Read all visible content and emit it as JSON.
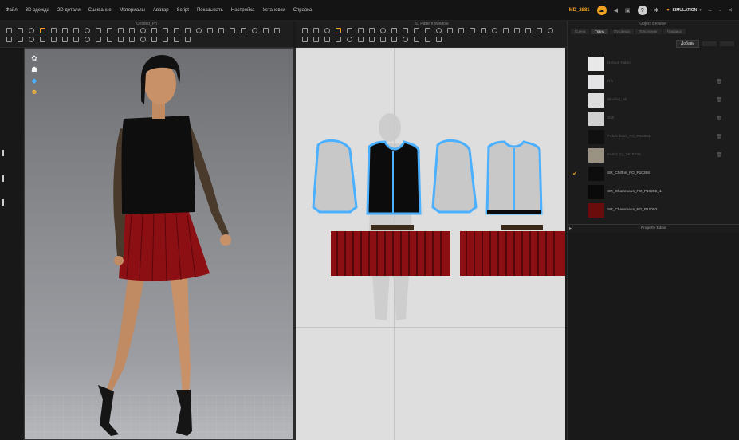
{
  "menubar": {
    "items": [
      "Файл",
      "3D одежда",
      "2D детали",
      "Сшивание",
      "Материалы",
      "Аватар",
      "Script",
      "Показывать",
      "Настройка",
      "Установки",
      "Справка"
    ],
    "project_badge": "MD_2881",
    "simulation_label": "SIMULATION"
  },
  "toolbar3d": {
    "title": "Untitled_Ph"
  },
  "toolbar2d": {
    "title": "2D Pattern Window"
  },
  "object_browser": {
    "title": "Object Browser",
    "tabs": [
      "Сцена",
      "Ткань",
      "Пуговица",
      "Топстичинг",
      "Графика"
    ],
    "active_tab": 1,
    "add_label": "Добавь",
    "fabrics": [
      {
        "name": "Default Fabric",
        "color": "#e8e8e8",
        "selected": false,
        "dim": true
      },
      {
        "name": "Rib",
        "color": "#e4e4e6",
        "selected": false,
        "dim": true
      },
      {
        "name": "Binding_Bk",
        "color": "#dcdcdc",
        "selected": false,
        "dim": true
      },
      {
        "name": "Sofi",
        "color": "#d0d0d0",
        "selected": false,
        "dim": true
      },
      {
        "name": "Fabric Dark_FC_PS2061",
        "color": "#101010",
        "selected": false,
        "dim": true
      },
      {
        "name": "Fabric Cy_MCB205",
        "color": "#9a9282",
        "selected": false,
        "dim": true
      },
      {
        "name": "SR_Chiffon_FO_P10398",
        "color": "#0d0d0d",
        "selected": true,
        "dim": false
      },
      {
        "name": "SR_Chammaus_FO_P10002_1",
        "color": "#0a0a0a",
        "selected": false,
        "dim": false
      },
      {
        "name": "SR_Chammaus_FO_P10002",
        "color": "#6a0c0c",
        "selected": false,
        "dim": false
      }
    ],
    "property_editor_label": "Property Editor"
  },
  "colors": {
    "accent": "#f0a020",
    "pattern_outline": "#4ab0ff",
    "skirt": "#8c0f14",
    "viewport_bg": "#8a8b8f"
  }
}
